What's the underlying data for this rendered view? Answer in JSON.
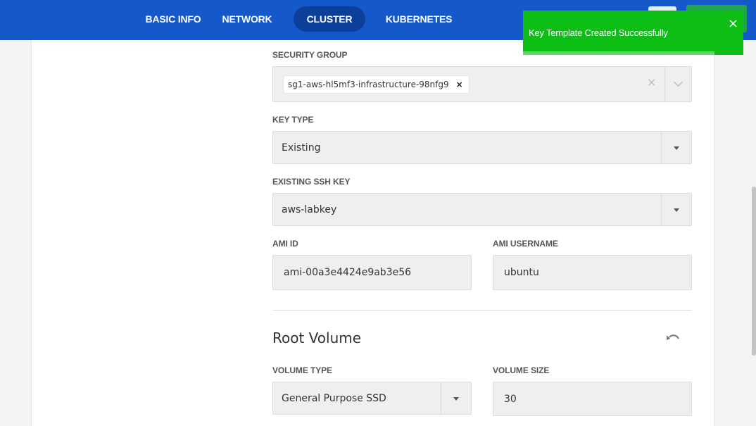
{
  "nav": {
    "tabs": [
      {
        "label": "BASIC INFO",
        "active": false
      },
      {
        "label": "NETWORK",
        "active": false
      },
      {
        "label": "CLUSTER",
        "active": true
      },
      {
        "label": "KUBERNETES",
        "active": false
      }
    ],
    "accent": "#1558c9",
    "active_bg": "#0c3f99"
  },
  "toast": {
    "message": "Key Template Created Successfully",
    "close": "×",
    "color": "#0dbf15",
    "progress_fraction": 0.87
  },
  "form": {
    "security_group": {
      "label": "SECURITY GROUP",
      "chip": "sg1-aws-hl5mf3-infrastructure-98nfg9",
      "chip_remove": "×",
      "clear": "×"
    },
    "key_type": {
      "label": "KEY TYPE",
      "value": "Existing"
    },
    "ssh_key": {
      "label": "EXISTING SSH KEY",
      "value": "aws-labkey"
    },
    "ami_id": {
      "label": "AMI ID",
      "value": "ami-00a3e4424e9ab3e56"
    },
    "ami_username": {
      "label": "AMI USERNAME",
      "value": "ubuntu"
    }
  },
  "root_volume": {
    "title": "Root Volume",
    "undo_icon": "undo-icon",
    "volume_type": {
      "label": "VOLUME TYPE",
      "value": "General Purpose SSD"
    },
    "volume_size": {
      "label": "VOLUME SIZE",
      "value": "30"
    }
  }
}
